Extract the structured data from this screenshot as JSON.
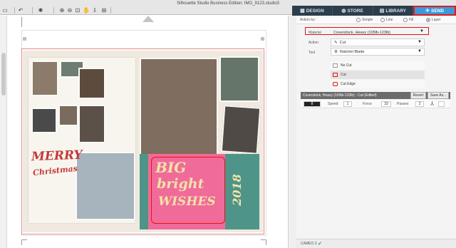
{
  "window": {
    "title": "Silhouette Studio Business Edition: IMG_9123.studio3"
  },
  "nav": {
    "tabs": [
      {
        "label": "DESIGN",
        "icon": "grid-icon"
      },
      {
        "label": "STORE",
        "icon": "globe-icon"
      },
      {
        "label": "LIBRARY",
        "icon": "library-icon"
      },
      {
        "label": "SEND",
        "icon": "send-icon",
        "active": true
      }
    ]
  },
  "send_panel": {
    "action_by_label": "Action by:",
    "modes": [
      "Simple",
      "Line",
      "Fill",
      "Layer"
    ],
    "selected_mode": "Layer",
    "material_label": "Material",
    "material_value": "Coverstock, Heavy (105lb-123lb)",
    "action_label": "Action",
    "action_value": "Cut",
    "tool_label": "Tool",
    "tool_value": "Ratchet Blade",
    "cut_options": [
      "No Cut",
      "Cut",
      "Cut Edge"
    ],
    "selected_cut": "Cut",
    "settings_header": "Coverstock, Heavy (105lb-123lb) : Cut (Edited)",
    "revert_label": "Revert",
    "save_as_label": "Save As...",
    "blade_value": "8",
    "speed_label": "Speed",
    "speed_value": "1",
    "force_label": "Force",
    "force_value": "33",
    "passes_label": "Passes",
    "passes_value": "2"
  },
  "status": {
    "device": "CAMEO 3"
  },
  "artwork": {
    "merry_text": "MERRY",
    "christmas_text": "Christmas",
    "big_text": "BIG",
    "bright_text": "bright",
    "wishes_text": "WISHES",
    "year_text": "2018"
  },
  "colors": {
    "send_tab": "#3a9ad9",
    "highlight_red": "#e01b1b",
    "teal": "#4f9488",
    "pink": "#f06b9a"
  }
}
